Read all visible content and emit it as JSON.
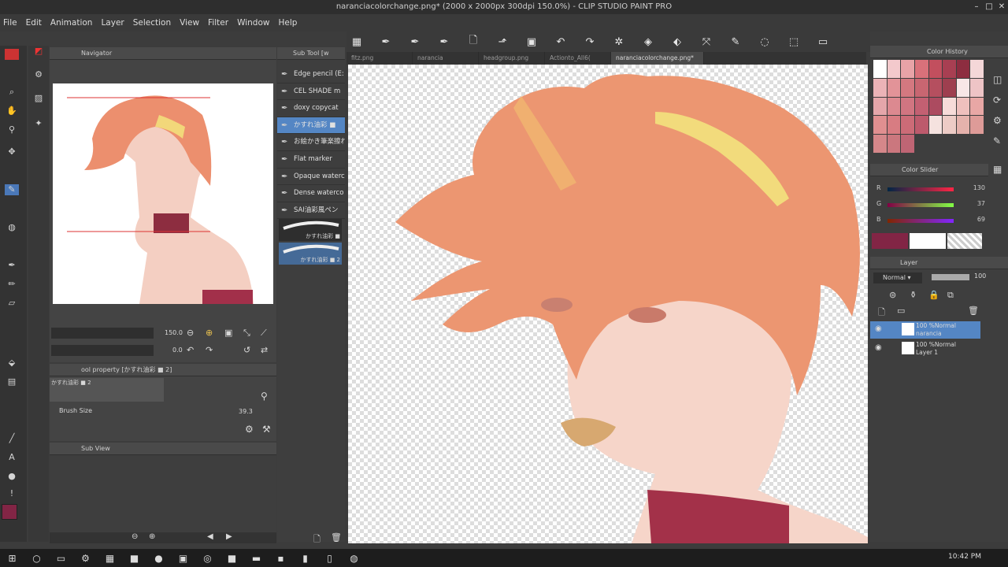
{
  "window": {
    "title": "naranciacolorchange.png* (2000 x 2000px 300dpi 150.0%) - CLIP STUDIO PAINT PRO",
    "minimize": "–",
    "maximize": "□",
    "close": "✕"
  },
  "menu": [
    "File",
    "Edit",
    "Animation",
    "Layer",
    "Selection",
    "View",
    "Filter",
    "Window",
    "Help"
  ],
  "navigator": {
    "title": "Navigator",
    "zoom": "150.0",
    "rotation": "0.0"
  },
  "subtool": {
    "title": "Sub Tool [w",
    "items": [
      "Edge pencil (E:",
      "CEL SHADE m",
      "doxy copycat",
      "かすれ油彩 ■",
      "お絵かき筆楽擦れ",
      "Flat marker",
      "Opaque waterc",
      "Dense waterco",
      "SAI油彩風ペン"
    ],
    "stroke_labels": [
      "かすれ油彩 ■",
      "かすれ油彩 ■ 2"
    ]
  },
  "toolprop": {
    "title": "ool property [かすれ油彩 ■ 2]",
    "brush_name": "かすれ油彩 ■ 2",
    "brush_size_label": "Brush Size",
    "brush_size_value": "39.3"
  },
  "subview": {
    "title": "Sub View"
  },
  "tabs": [
    "fitz.png",
    "narancia",
    "headgroup.png",
    "Actionto_All6(",
    "naranciacolorchange.png*"
  ],
  "color_history": {
    "title": "Color History",
    "colors": [
      "#ffffff",
      "#f3c9cc",
      "#e8a3a7",
      "#d9717a",
      "#c24f5e",
      "#a83f52",
      "#8d2d40",
      "#f4d7d8",
      "#ebb3b7",
      "#e29398",
      "#d47880",
      "#c86671",
      "#b54f5f",
      "#9e3f4f",
      "#f8e6e6",
      "#eec4c6",
      "#e5a6aa",
      "#dc8990",
      "#d17581",
      "#c36072",
      "#ac4b60",
      "#f7dcd9",
      "#efc0bd",
      "#e8a7a5",
      "#e08f90",
      "#d87c82",
      "#cc6b77",
      "#bd5a6c",
      "#f5e2df",
      "#edccc6",
      "#e5b2ac",
      "#de9b98",
      "#d5878a",
      "#cb777e",
      "#bf6574"
    ]
  },
  "color_slider": {
    "title": "Color Slider",
    "r": 130,
    "g": 37,
    "b": 69,
    "r_label": "R",
    "g_label": "G",
    "b_label": "B",
    "main_color": "#822545",
    "sub_color": "#ffffff"
  },
  "layer": {
    "title": "Layer",
    "blend_mode": "Normal",
    "opacity": "100",
    "layers": [
      {
        "line1": "100 %Normal",
        "line2": "narancia",
        "selected": true
      },
      {
        "line1": "100 %Normal",
        "line2": "Layer 1",
        "selected": false
      }
    ]
  },
  "taskbar": {
    "time": "10:42 PM"
  }
}
